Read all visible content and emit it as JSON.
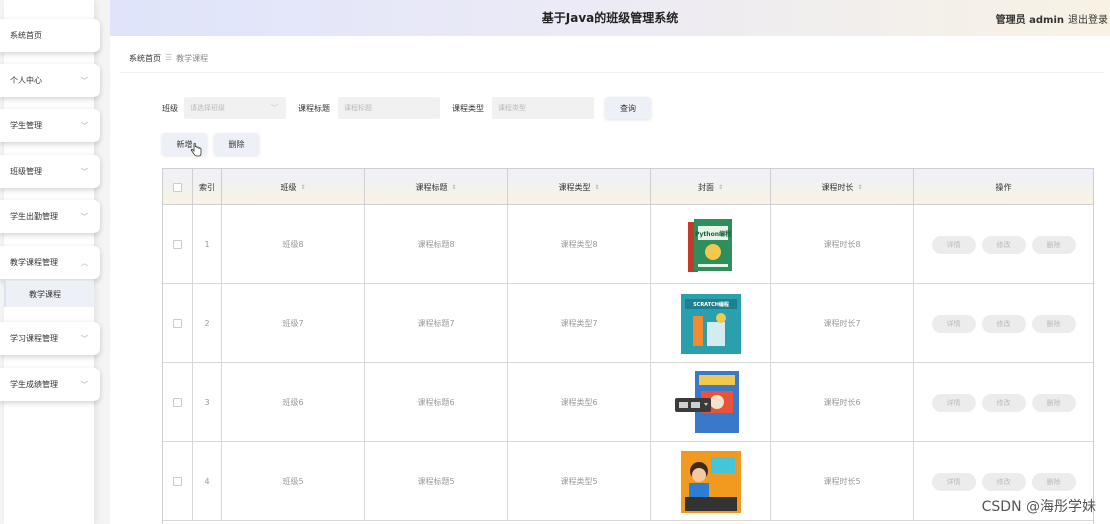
{
  "header": {
    "title": "基于Java的班级管理系统",
    "user": "管理员 admin",
    "logout": "退出登录"
  },
  "sidebar": {
    "items": [
      {
        "label": "系统首页",
        "has_arrow": false
      },
      {
        "label": "个人中心",
        "has_arrow": true
      },
      {
        "label": "学生管理",
        "has_arrow": true
      },
      {
        "label": "班级管理",
        "has_arrow": true
      },
      {
        "label": "学生出勤管理",
        "has_arrow": true
      },
      {
        "label": "教学课程管理",
        "has_arrow": true,
        "expanded": true
      },
      {
        "label": "学习课程管理",
        "has_arrow": true
      },
      {
        "label": "学生成绩管理",
        "has_arrow": true
      }
    ],
    "submenu": {
      "label": "教学课程"
    }
  },
  "breadcrumb": {
    "home": "系统首页",
    "separator": "☰",
    "current": "教学课程"
  },
  "filters": {
    "class_label": "班级",
    "class_placeholder": "请选择班级",
    "title_label": "课程标题",
    "title_placeholder": "课程标题",
    "type_label": "课程类型",
    "type_placeholder": "课程类型",
    "query_button": "查询"
  },
  "actions": {
    "add": "新增",
    "delete": "删除"
  },
  "table": {
    "headers": {
      "index": "索引",
      "class": "班级",
      "title": "课程标题",
      "type": "课程类型",
      "cover": "封面",
      "duration": "课程时长",
      "ops": "操作"
    },
    "rows": [
      {
        "index": "1",
        "class": "班级8",
        "title": "课程标题8",
        "type": "课程类型8",
        "duration": "课程时长8",
        "cover_text": "Python编程"
      },
      {
        "index": "2",
        "class": "班级7",
        "title": "课程标题7",
        "type": "课程类型7",
        "duration": "课程时长7",
        "cover_text": "SCRATCH编程"
      },
      {
        "index": "3",
        "class": "班级6",
        "title": "课程标题6",
        "type": "课程类型6",
        "duration": "课程时长6",
        "cover_text": ""
      },
      {
        "index": "4",
        "class": "班级5",
        "title": "课程标题5",
        "type": "课程类型5",
        "duration": "课程时长5",
        "cover_text": ""
      }
    ],
    "op_labels": {
      "detail": "详情",
      "edit": "修改",
      "delete": "删除"
    }
  },
  "watermark": "CSDN @海彤学妹",
  "colors": {
    "header_left": "#dfe4fb",
    "header_right": "#f8f2e4",
    "button_bg": "#eef0f8"
  }
}
